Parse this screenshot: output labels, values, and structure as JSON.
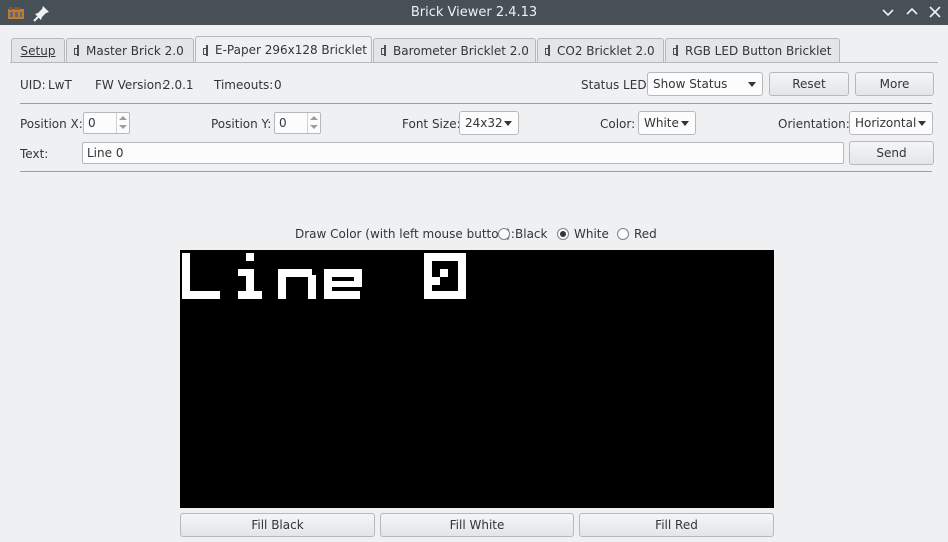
{
  "window": {
    "title": "Brick Viewer 2.4.13"
  },
  "tabs": [
    {
      "label": "Setup"
    },
    {
      "label": "Master Brick 2.0"
    },
    {
      "label": "E-Paper 296x128 Bricklet"
    },
    {
      "label": "Barometer Bricklet 2.0"
    },
    {
      "label": "CO2 Bricklet 2.0"
    },
    {
      "label": "RGB LED Button Bricklet"
    }
  ],
  "info": {
    "uid_label": "UID:",
    "uid_value": "LwT",
    "fw_label": "FW Version:",
    "fw_value": "2.0.1",
    "timeouts_label": "Timeouts:",
    "timeouts_value": "0",
    "status_led_label": "Status LED:",
    "status_led_value": "Show Status",
    "reset_label": "Reset",
    "more_label": "More"
  },
  "controls": {
    "pos_x_label": "Position X:",
    "pos_x_value": "0",
    "pos_y_label": "Position Y:",
    "pos_y_value": "0",
    "font_size_label": "Font Size:",
    "font_size_value": "24x32",
    "color_label": "Color:",
    "color_value": "White",
    "orientation_label": "Orientation:",
    "orientation_value": "Horizontal",
    "text_label": "Text:",
    "text_value": "Line 0",
    "send_label": "Send"
  },
  "draw": {
    "label": "Draw Color (with left mouse button):",
    "options": [
      "Black",
      "White",
      "Red"
    ],
    "selected": "White",
    "display_text": "Line 0"
  },
  "fill_buttons": {
    "black": "Fill Black",
    "white": "Fill White",
    "red": "Fill Red"
  }
}
